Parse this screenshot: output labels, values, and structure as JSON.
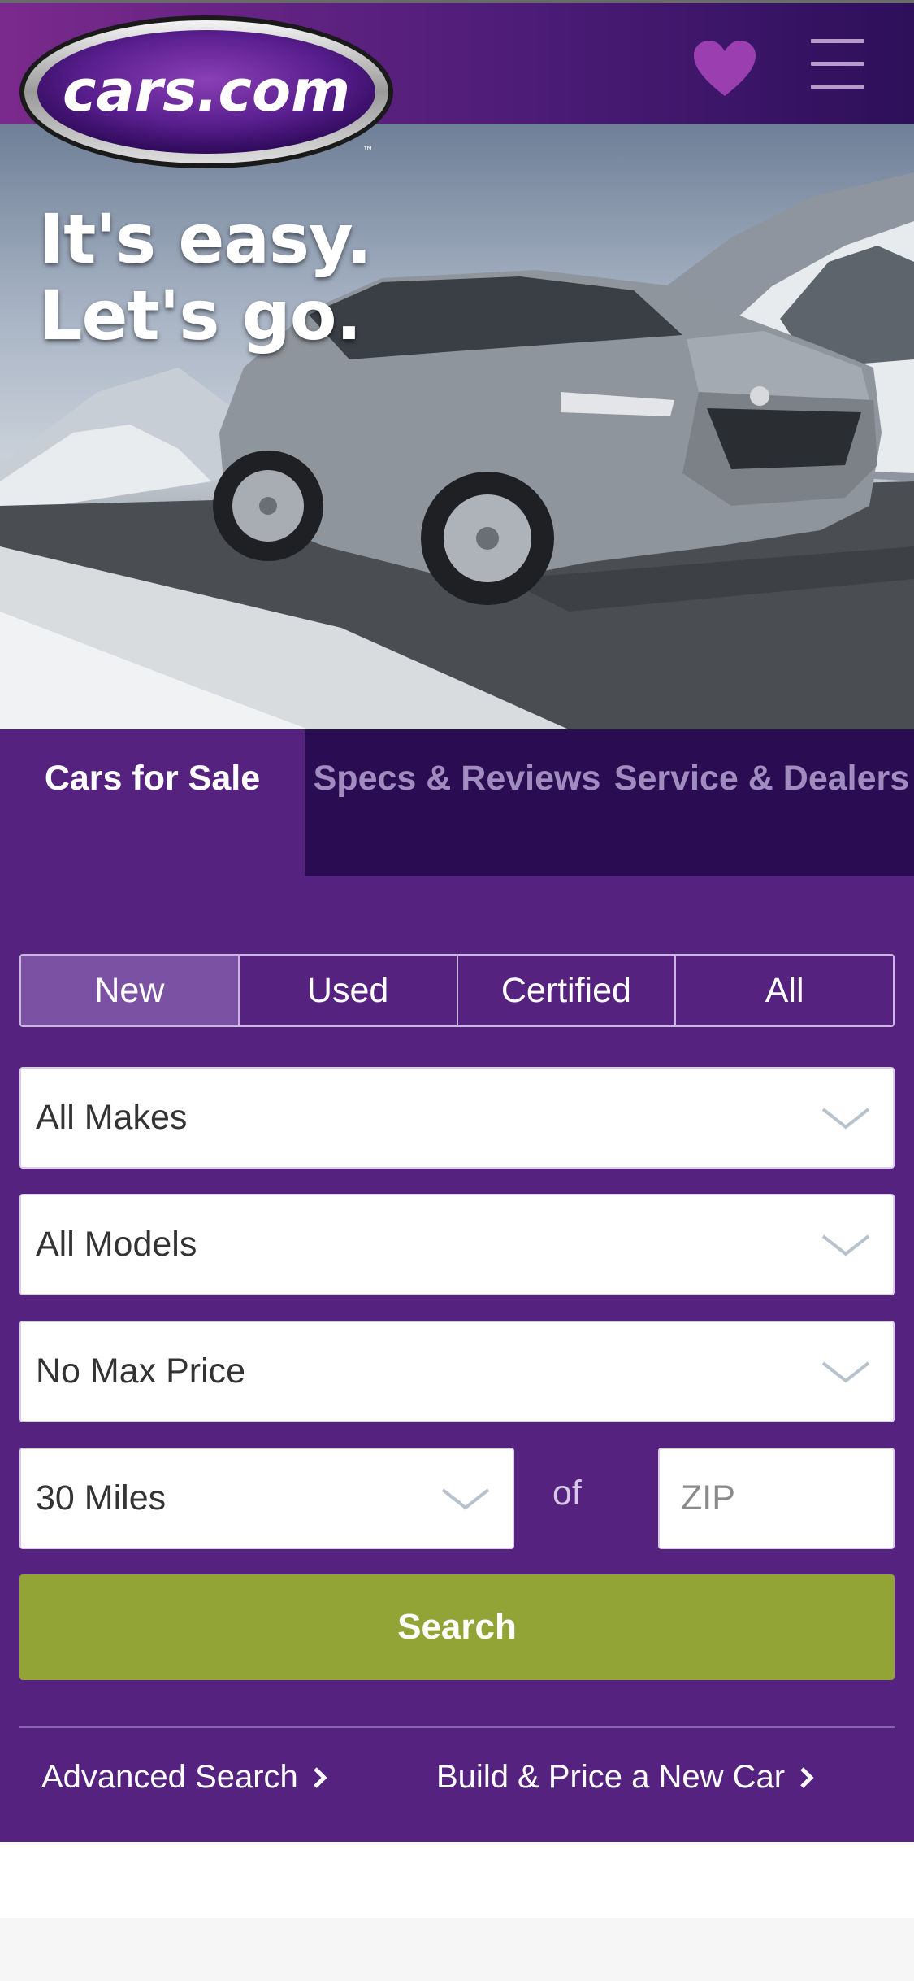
{
  "header": {
    "logo_text": "cars.com",
    "logo_tm": "™",
    "favorites_icon": "heart-icon",
    "menu_icon": "hamburger-menu-icon",
    "colors": {
      "brand_purple": "#55237f",
      "heart": "#9b3fb0"
    }
  },
  "hero": {
    "line1": "It's easy.",
    "line2": "Let's go."
  },
  "tabs": [
    {
      "label": "Cars for Sale",
      "active": true
    },
    {
      "label": "Specs & Reviews",
      "active": false
    },
    {
      "label": "Service & Dealers",
      "active": false
    }
  ],
  "search": {
    "condition": [
      {
        "label": "New",
        "active": true
      },
      {
        "label": "Used",
        "active": false
      },
      {
        "label": "Certified",
        "active": false
      },
      {
        "label": "All",
        "active": false
      }
    ],
    "make": "All Makes",
    "model": "All Models",
    "price": "No Max Price",
    "distance": "30 Miles",
    "of_label": "of",
    "zip_placeholder": "ZIP",
    "button": "Search",
    "button_color": "#93a437"
  },
  "links": {
    "advanced": "Advanced Search",
    "build_price": "Build & Price a New Car"
  }
}
